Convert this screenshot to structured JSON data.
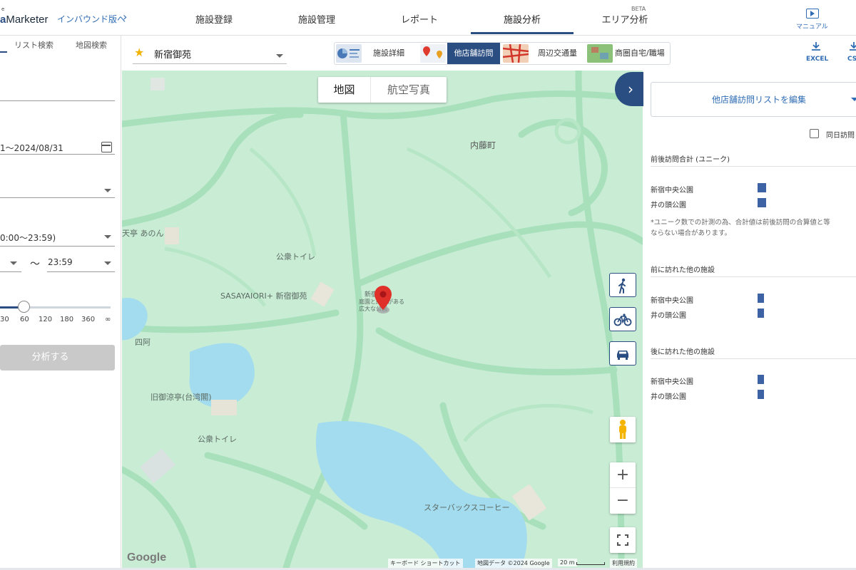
{
  "app": {
    "logo_text": "Marketer",
    "logo_sup": "e",
    "inbound_link": "インバウンド版へ"
  },
  "nav": {
    "items": [
      {
        "label": "施設登録"
      },
      {
        "label": "施設管理"
      },
      {
        "label": "レポート"
      },
      {
        "label": "施設分析"
      },
      {
        "label": "エリア分析"
      }
    ],
    "active": "施設分析",
    "beta": "BETA",
    "manual": "マニュアル"
  },
  "left": {
    "tabs": [
      "リスト検索",
      "地図検索"
    ],
    "date_range": "1〜2024/08/31",
    "time_preset": "0:00〜23:59)",
    "time_sep": "〜",
    "time_to": "23:59",
    "slider_ticks": [
      "30",
      "60",
      "120",
      "180",
      "360",
      "∞"
    ],
    "slider_value": 30,
    "analyze_button": "分析する"
  },
  "header": {
    "facility_name": "新宿御苑",
    "view_tabs": [
      "施設詳細",
      "他店舗訪問",
      "周辺交通量",
      "商圏自宅/職場"
    ],
    "active_view": "他店舗訪問",
    "excel": "EXCEL",
    "csv": "CS"
  },
  "map": {
    "toggle": [
      "地図",
      "航空写真"
    ],
    "active_toggle": "地図",
    "labels": [
      {
        "text": "内藤町"
      },
      {
        "text": "天亭 あのん"
      },
      {
        "text": "公衆トイレ"
      },
      {
        "text": "SASAYAIORI+ 新宿御苑"
      },
      {
        "text": "新宿御苑"
      },
      {
        "text": "庭園と緑地がある広大な公園"
      },
      {
        "text": "四阿"
      },
      {
        "text": "旧御涼亭(台湾閣)"
      },
      {
        "text": "公衆トイレ"
      },
      {
        "text": "スターバックスコーヒー"
      }
    ],
    "attribution": {
      "shortcuts": "キーボード ショートカット",
      "data": "地図データ ©2024 Google",
      "scale": "20 m",
      "terms": "利用規約"
    },
    "google": "Google",
    "zoom_in": "+",
    "zoom_out": "−"
  },
  "right": {
    "edit_button": "他店舗訪問リストを編集",
    "same_day_checkbox": "同日訪問",
    "sections": [
      {
        "title": "前後訪問合計 (ユニーク)",
        "rows": [
          {
            "name": "新宿中央公園"
          },
          {
            "name": "井の頭公園"
          }
        ]
      },
      {
        "title": "前に訪れた他の施設",
        "rows": [
          {
            "name": "新宿中央公園"
          },
          {
            "name": "井の頭公園"
          }
        ]
      },
      {
        "title": "後に訪れた他の施設",
        "rows": [
          {
            "name": "新宿中央公園"
          },
          {
            "name": "井の頭公園"
          }
        ]
      }
    ],
    "note_line1": "*ユニーク数での計測の為、合計値は前後訪問の合算値と等",
    "note_line2": "ならない場合があります。"
  },
  "colors": {
    "primary": "#2b4e82",
    "link": "#2f6cb3",
    "bar": "#3d63a4",
    "map_bg": "#c9ecd5",
    "water": "#a3dcef",
    "road": "#a8e0bc"
  },
  "icons": [
    "chevron-right-icon",
    "manual-video-icon",
    "calendar-icon",
    "star-icon",
    "download-icon",
    "walk-icon",
    "bicycle-icon",
    "car-icon",
    "pegman-icon",
    "fullscreen-icon",
    "map-pin-icon"
  ]
}
